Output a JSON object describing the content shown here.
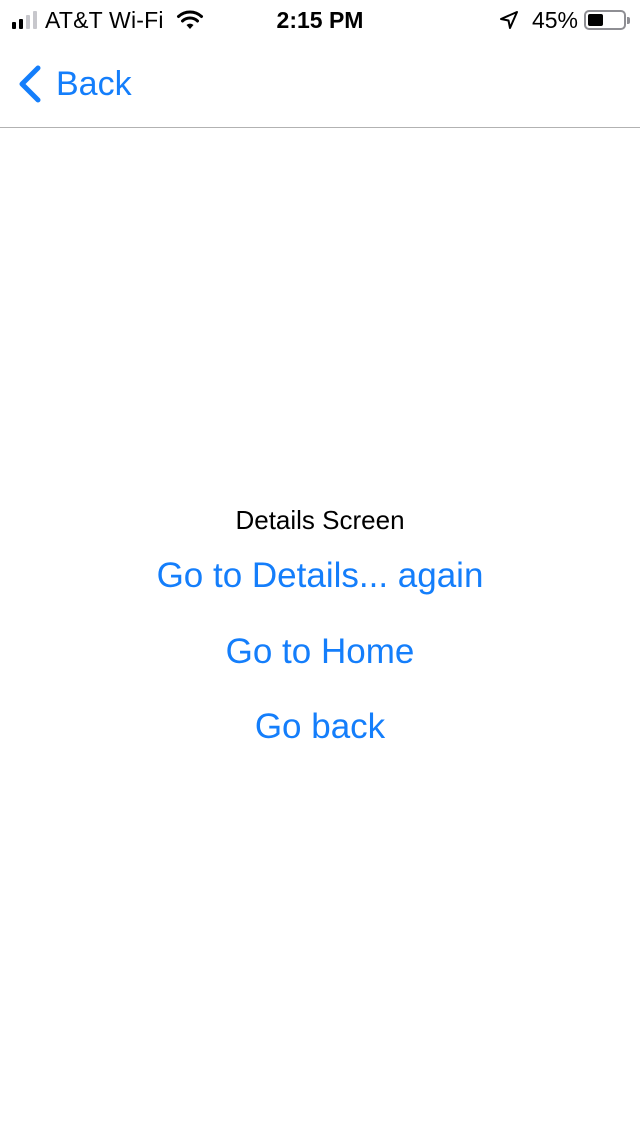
{
  "status_bar": {
    "carrier": "AT&T Wi-Fi",
    "time": "2:15 PM",
    "battery_percent": "45%",
    "battery_level": 0.45,
    "signal_bars_filled": 2,
    "signal_bars_total": 4,
    "icons": [
      "signal-icon",
      "wifi-icon",
      "location-arrow-icon",
      "battery-icon"
    ]
  },
  "nav": {
    "back_label": "Back"
  },
  "content": {
    "title": "Details Screen",
    "buttons": [
      {
        "label": "Go to Details... again"
      },
      {
        "label": "Go to Home"
      },
      {
        "label": "Go back"
      }
    ]
  },
  "colors": {
    "accent": "#147efb",
    "text": "#000000",
    "background": "#ffffff",
    "divider": "#b2b2b2",
    "inactive_signal": "#c7c7cc"
  }
}
